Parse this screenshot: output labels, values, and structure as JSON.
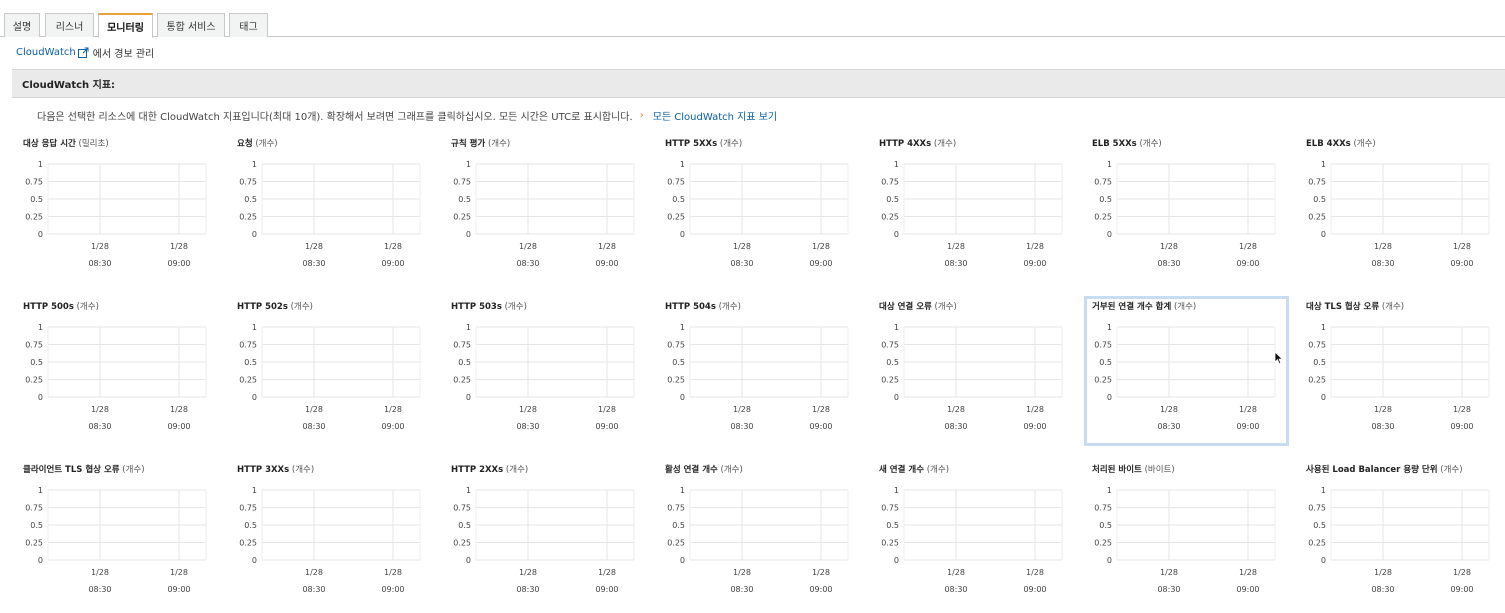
{
  "tabs": [
    {
      "label": "설명"
    },
    {
      "label": "리스너"
    },
    {
      "label": "모니터링"
    },
    {
      "label": "통합 서비스"
    },
    {
      "label": "태그"
    }
  ],
  "cloudwatch_link": {
    "link_text": "CloudWatch",
    "rest_text": "에서 경보 관리"
  },
  "section_title": "CloudWatch 지표:",
  "description": {
    "text": "다음은 선택한 리소스에 대한 CloudWatch 지표입니다(최대 10개). 확장해서 보려면 그래프를 클릭하십시오. 모든 시간은 UTC로 표시합니다.",
    "link": "모든 CloudWatch 지표 보기"
  },
  "y_ticks": [
    "1",
    "0.75",
    "0.5",
    "0.25",
    "0"
  ],
  "x_ticks": [
    {
      "date": "1/28",
      "time": "08:30"
    },
    {
      "date": "1/28",
      "time": "09:00"
    }
  ],
  "metrics": [
    {
      "name": "대상 응답 시간",
      "unit": "(밀리초)"
    },
    {
      "name": "요청",
      "unit": "(개수)"
    },
    {
      "name": "규칙 평가",
      "unit": "(개수)"
    },
    {
      "name": "HTTP 5XXs",
      "unit": "(개수)"
    },
    {
      "name": "HTTP 4XXs",
      "unit": "(개수)"
    },
    {
      "name": "ELB 5XXs",
      "unit": "(개수)"
    },
    {
      "name": "ELB 4XXs",
      "unit": "(개수)"
    },
    {
      "name": "HTTP 500s",
      "unit": "(개수)"
    },
    {
      "name": "HTTP 502s",
      "unit": "(개수)"
    },
    {
      "name": "HTTP 503s",
      "unit": "(개수)"
    },
    {
      "name": "HTTP 504s",
      "unit": "(개수)"
    },
    {
      "name": "대상 연결 오류",
      "unit": "(개수)"
    },
    {
      "name": "거부된 연결 개수 합계",
      "unit": "(개수)"
    },
    {
      "name": "대상 TLS 협상 오류",
      "unit": "(개수)"
    },
    {
      "name": "클라이언트 TLS 협상 오류",
      "unit": "(개수)"
    },
    {
      "name": "HTTP 3XXs",
      "unit": "(개수)"
    },
    {
      "name": "HTTP 2XXs",
      "unit": "(개수)"
    },
    {
      "name": "활성 연결 개수",
      "unit": "(개수)"
    },
    {
      "name": "새 연결 개수",
      "unit": "(개수)"
    },
    {
      "name": "처리된 바이트",
      "unit": "(바이트)"
    },
    {
      "name": "사용된 Load Balancer 용량 단위",
      "unit": "(개수)"
    }
  ],
  "colors": {
    "accent_tab": "#e8a13a",
    "link": "#0b61a4",
    "highlight": "#c7dcf0",
    "grid": "#e6e6e6"
  }
}
